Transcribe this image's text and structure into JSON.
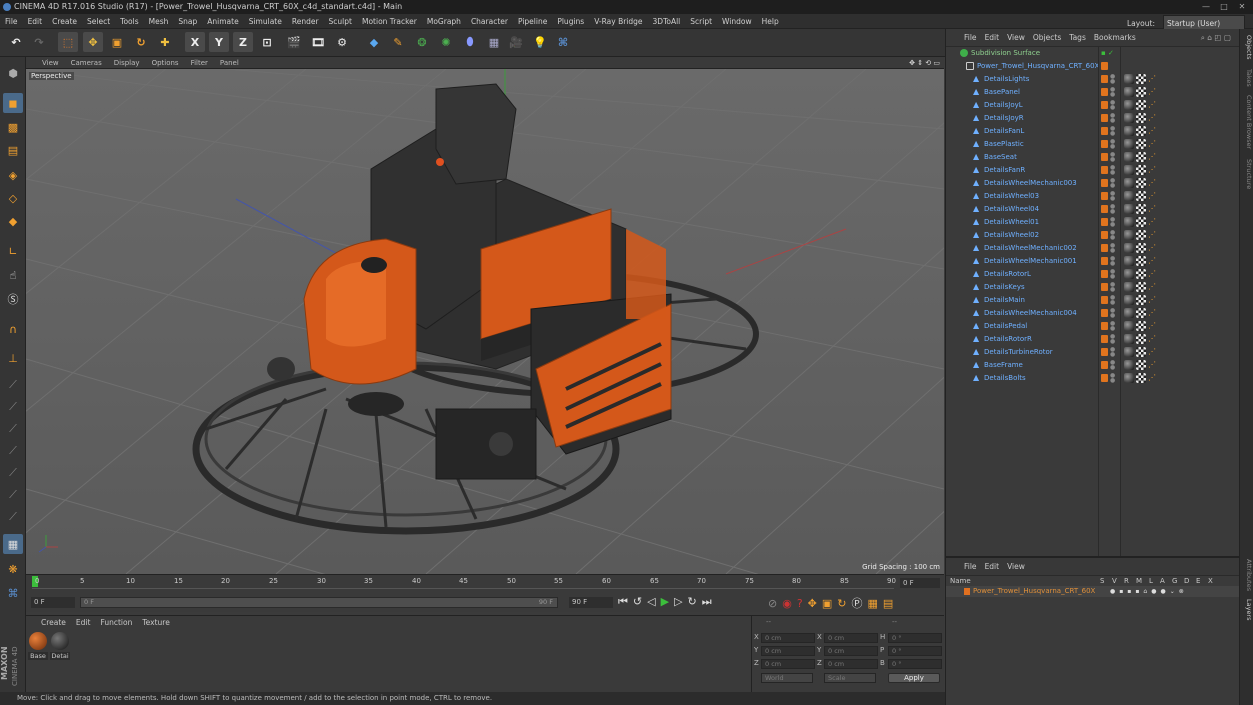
{
  "app": {
    "title": "CINEMA 4D R17.016 Studio (R17) - [Power_Trowel_Husqvarna_CRT_60X_c4d_standart.c4d] - Main",
    "layout_label": "Layout:",
    "layout_value": "Startup (User)"
  },
  "menu": [
    "File",
    "Edit",
    "Create",
    "Select",
    "Tools",
    "Mesh",
    "Snap",
    "Animate",
    "Simulate",
    "Render",
    "Sculpt",
    "Motion Tracker",
    "MoGraph",
    "Character",
    "Pipeline",
    "Plugins",
    "V-Ray Bridge",
    "3DToAll",
    "Script",
    "Window",
    "Help"
  ],
  "toolbar": {
    "x_label": "X",
    "y_label": "Y",
    "z_label": "Z"
  },
  "viewport": {
    "menu": [
      "View",
      "Cameras",
      "Display",
      "Options",
      "Filter",
      "Panel"
    ],
    "camera_label": "Perspective",
    "grid_spacing": "Grid Spacing : 100 cm"
  },
  "timeline": {
    "ticks": [
      "0",
      "5",
      "10",
      "15",
      "20",
      "25",
      "30",
      "35",
      "40",
      "45",
      "50",
      "55",
      "60",
      "65",
      "70",
      "75",
      "80",
      "85",
      "90"
    ],
    "current_frame": "0 F",
    "start_frame": "0 F",
    "range_start": "0 F",
    "range_end": "90 F",
    "end_frame": "90 F",
    "playhead": 0.0
  },
  "material_panel": {
    "menu": [
      "Create",
      "Edit",
      "Function",
      "Texture"
    ],
    "materials": [
      "Base",
      "Detai"
    ],
    "brand_top": "MAXON",
    "brand_bottom": "CINEMA 4D"
  },
  "coordinates": {
    "header_left": "--",
    "header_right": "--",
    "rows": [
      {
        "a": "X",
        "av": "0 cm",
        "b": "X",
        "bv": "0 cm",
        "c": "H",
        "cv": "0 °"
      },
      {
        "a": "Y",
        "av": "0 cm",
        "b": "Y",
        "bv": "0 cm",
        "c": "P",
        "cv": "0 °"
      },
      {
        "a": "Z",
        "av": "0 cm",
        "b": "Z",
        "bv": "0 cm",
        "c": "B",
        "cv": "0 °"
      }
    ],
    "mode_world": "World",
    "mode_scale": "Scale",
    "apply_label": "Apply"
  },
  "status": "Move: Click and drag to move elements. Hold down SHIFT to quantize movement / add to the selection in point mode, CTRL to remove.",
  "object_manager": {
    "menu": [
      "File",
      "Edit",
      "View",
      "Objects",
      "Tags",
      "Bookmarks"
    ],
    "root": "Subdivision Surface",
    "parent": "Power_Trowel_Husqvarna_CRT_60X",
    "children": [
      "DetailsLights",
      "BasePanel",
      "DetailsJoyL",
      "DetailsJoyR",
      "DetailsFanL",
      "BasePlastic",
      "BaseSeat",
      "DetailsFanR",
      "DetailsWheelMechanic003",
      "DetailsWheel03",
      "DetailsWheel04",
      "DetailsWheel01",
      "DetailsWheel02",
      "DetailsWheelMechanic002",
      "DetailsWheelMechanic001",
      "DetailsRotorL",
      "DetailsKeys",
      "DetailsMain",
      "DetailsWheelMechanic004",
      "DetailsPedal",
      "DetailsRotorR",
      "DetailsTurbineRotor",
      "BaseFrame",
      "DetailsBolts"
    ]
  },
  "attribute_manager": {
    "menu": [
      "File",
      "Edit",
      "View"
    ],
    "name_header": "Name",
    "columns": [
      "S",
      "V",
      "R",
      "M",
      "L",
      "A",
      "G",
      "D",
      "E",
      "X"
    ],
    "item": "Power_Trowel_Husqvarna_CRT_60X"
  },
  "right_tabs": [
    "Objects",
    "Takes",
    "Content Browser",
    "Structure",
    "Attributes",
    "Layers"
  ],
  "colors": {
    "accent_orange": "#e0741e",
    "object_blue": "#6fb0ff",
    "layer_orange": "#e07020"
  }
}
